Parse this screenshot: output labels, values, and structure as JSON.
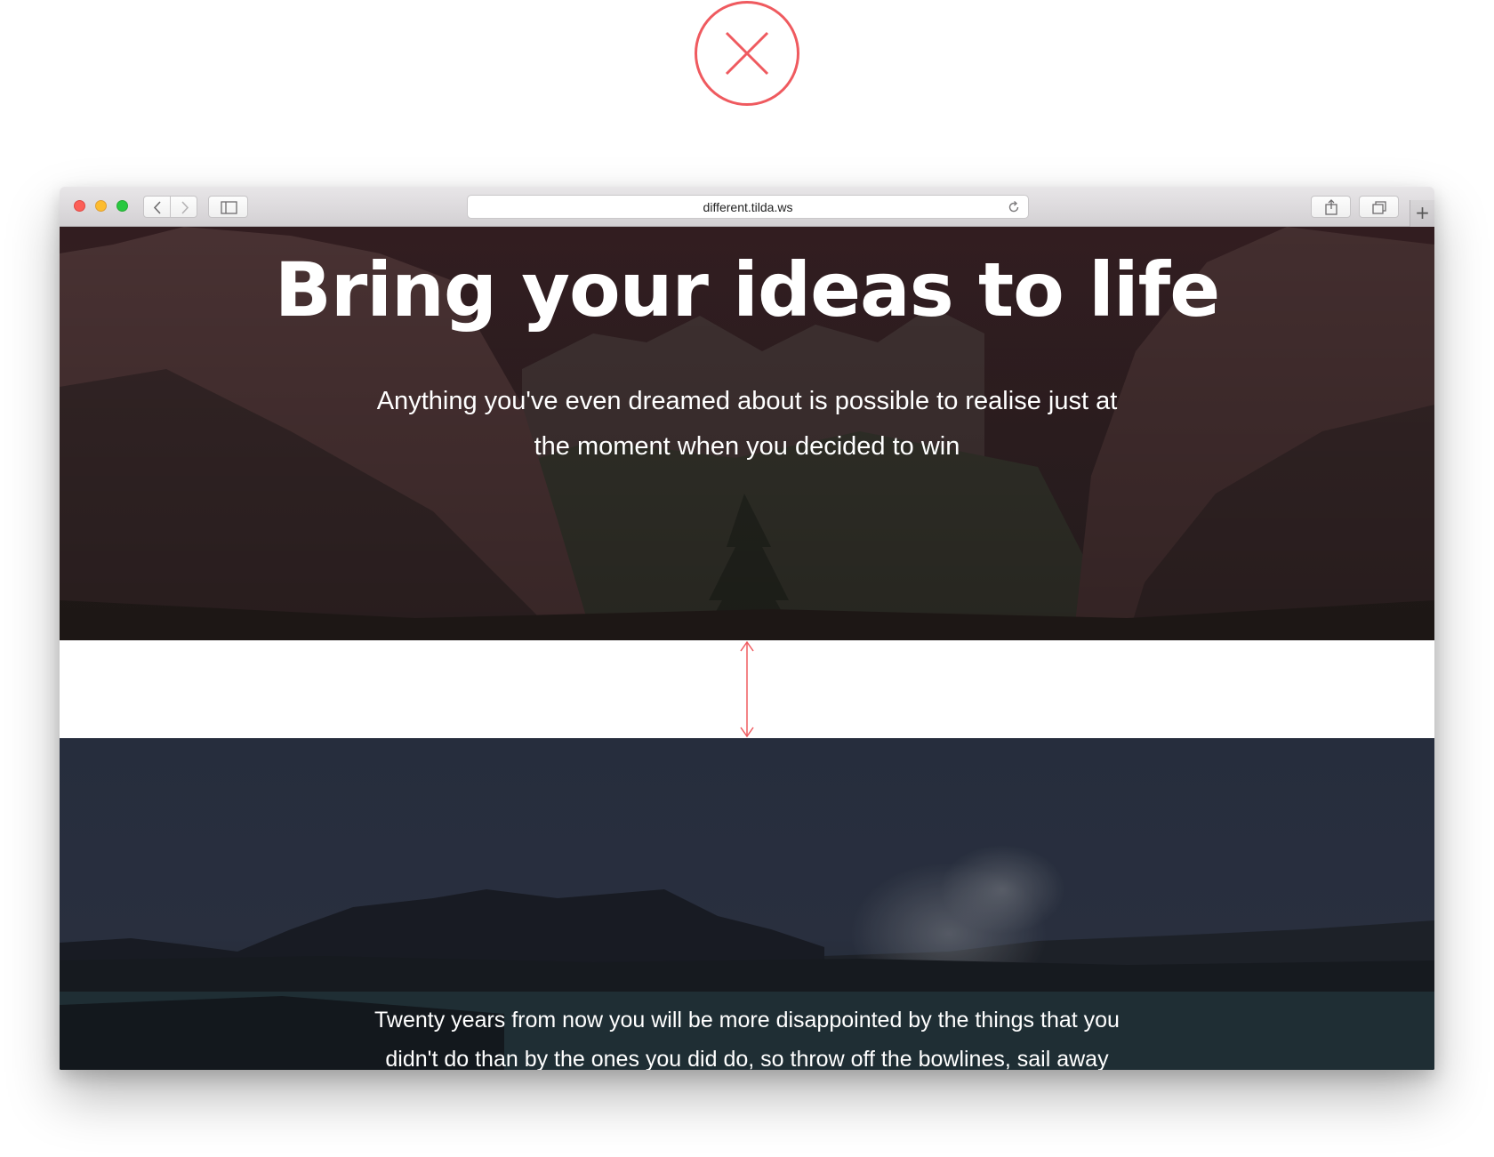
{
  "status_badge": {
    "icon": "close-icon",
    "color": "#ef5a5f"
  },
  "browser": {
    "url": "different.tilda.ws",
    "icons": {
      "back": "chevron-left-icon",
      "forward": "chevron-right-icon",
      "sidebar": "sidebar-icon",
      "reload": "reload-icon",
      "share": "share-icon",
      "tabs": "tabs-overview-icon",
      "new_tab": "plus-icon"
    },
    "new_tab_label": "+"
  },
  "page": {
    "hero": {
      "title": "Bring your ideas to life",
      "subtitle": "Anything you've even dreamed about is possible to realise just at the moment when you decided to win"
    },
    "spacing_indicator": {
      "icon": "double-arrow-vertical-icon",
      "color": "#ef5a5f"
    },
    "lower": {
      "text": "Twenty years from now you will be more disappointed by the things that you didn't do than by the ones you did do, so throw off the bowlines, sail away"
    }
  }
}
